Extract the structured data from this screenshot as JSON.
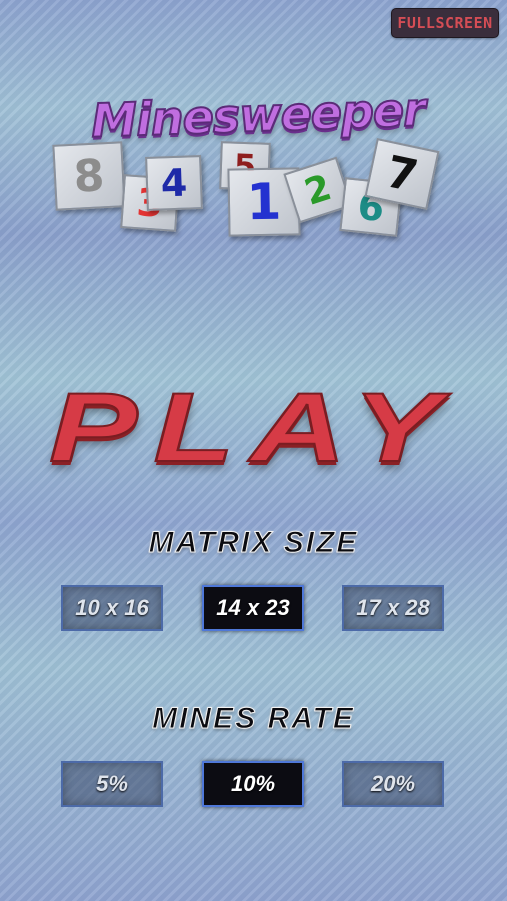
{
  "header": {
    "fullscreen_label": "FULLSCREEN"
  },
  "logo": {
    "title": "Minesweeper",
    "tiles": [
      "8",
      "3",
      "4",
      "5",
      "1",
      "2",
      "6",
      "7"
    ]
  },
  "play": {
    "label": "PLAY"
  },
  "matrix_size": {
    "title": "MATRIX SIZE",
    "options": [
      "10 x 16",
      "14 x 23",
      "17 x 28"
    ],
    "selected": "14 x 23"
  },
  "mines_rate": {
    "title": "MINES RATE",
    "options": [
      "5%",
      "10%",
      "20%"
    ],
    "selected": "10%"
  },
  "colors": {
    "accent_red": "#d63b46",
    "selected_border": "#4f78d8",
    "logo_purple": "#c06ee0"
  }
}
